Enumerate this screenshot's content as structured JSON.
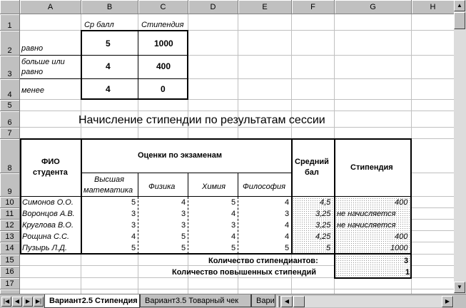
{
  "columns": [
    "A",
    "B",
    "C",
    "D",
    "E",
    "F",
    "G",
    "H"
  ],
  "rows": [
    "1",
    "2",
    "3",
    "4",
    "5",
    "6",
    "7",
    "8",
    "9",
    "10",
    "11",
    "12",
    "13",
    "14",
    "15",
    "16",
    "17"
  ],
  "criteria": {
    "header_avg": "Ср балл",
    "header_stipend": "Стипендия",
    "rows": [
      {
        "label": "равно",
        "avg": "5",
        "stipend": "1000"
      },
      {
        "label_line1": "больше или",
        "label_line2": "равно",
        "avg": "4",
        "stipend": "400"
      },
      {
        "label": "менее",
        "avg": "4",
        "stipend": "0"
      }
    ]
  },
  "title": "Начисление стипендии по результатам сессии",
  "table": {
    "fio_line1": "ФИО",
    "fio_line2": "студента",
    "exams_header": "Оценки по экзаменам",
    "avg_line1": "Средний",
    "avg_line2": "бал",
    "stipend_header": "Стипендия",
    "subjects": [
      {
        "line1": "Высшая",
        "line2": "математика"
      },
      {
        "line1": "Физика"
      },
      {
        "line1": "Химия"
      },
      {
        "line1": "Философия"
      }
    ],
    "students": [
      {
        "name": "Симонов О.О.",
        "math": "5",
        "phys": "4",
        "chem": "5",
        "phil": "4",
        "avg": "4,5",
        "stipend": "400"
      },
      {
        "name": "Воронцов А.В.",
        "math": "3",
        "phys": "3",
        "chem": "4",
        "phil": "3",
        "avg": "3,25",
        "stipend": "не начисляется"
      },
      {
        "name": "Круглова В.О.",
        "math": "3",
        "phys": "3",
        "chem": "3",
        "phil": "4",
        "avg": "3,25",
        "stipend": "не начисляется"
      },
      {
        "name": "Рощина С.С.",
        "math": "4",
        "phys": "5",
        "chem": "4",
        "phil": "4",
        "avg": "4,25",
        "stipend": "400"
      },
      {
        "name": "Пузырь Л.Д.",
        "math": "5",
        "phys": "5",
        "chem": "5",
        "phil": "5",
        "avg": "5",
        "stipend": "1000"
      }
    ],
    "count_label": "Количество стипендиантов:",
    "count_value": "3",
    "increased_label": "Количество повышенных стипендий",
    "increased_value": "1"
  },
  "tabs": [
    {
      "label": "Вариант2.5 Стипендия",
      "active": true
    },
    {
      "label": "Вариант3.5  Товарный чек",
      "active": false
    },
    {
      "label": "Вари",
      "active": false
    }
  ],
  "icons": {
    "first": "first-sheet-icon",
    "prev": "prev-sheet-icon",
    "next": "next-sheet-icon",
    "last": "last-sheet-icon",
    "up": "scroll-up-icon",
    "down": "scroll-down-icon",
    "left": "scroll-left-icon",
    "right": "scroll-right-icon"
  }
}
